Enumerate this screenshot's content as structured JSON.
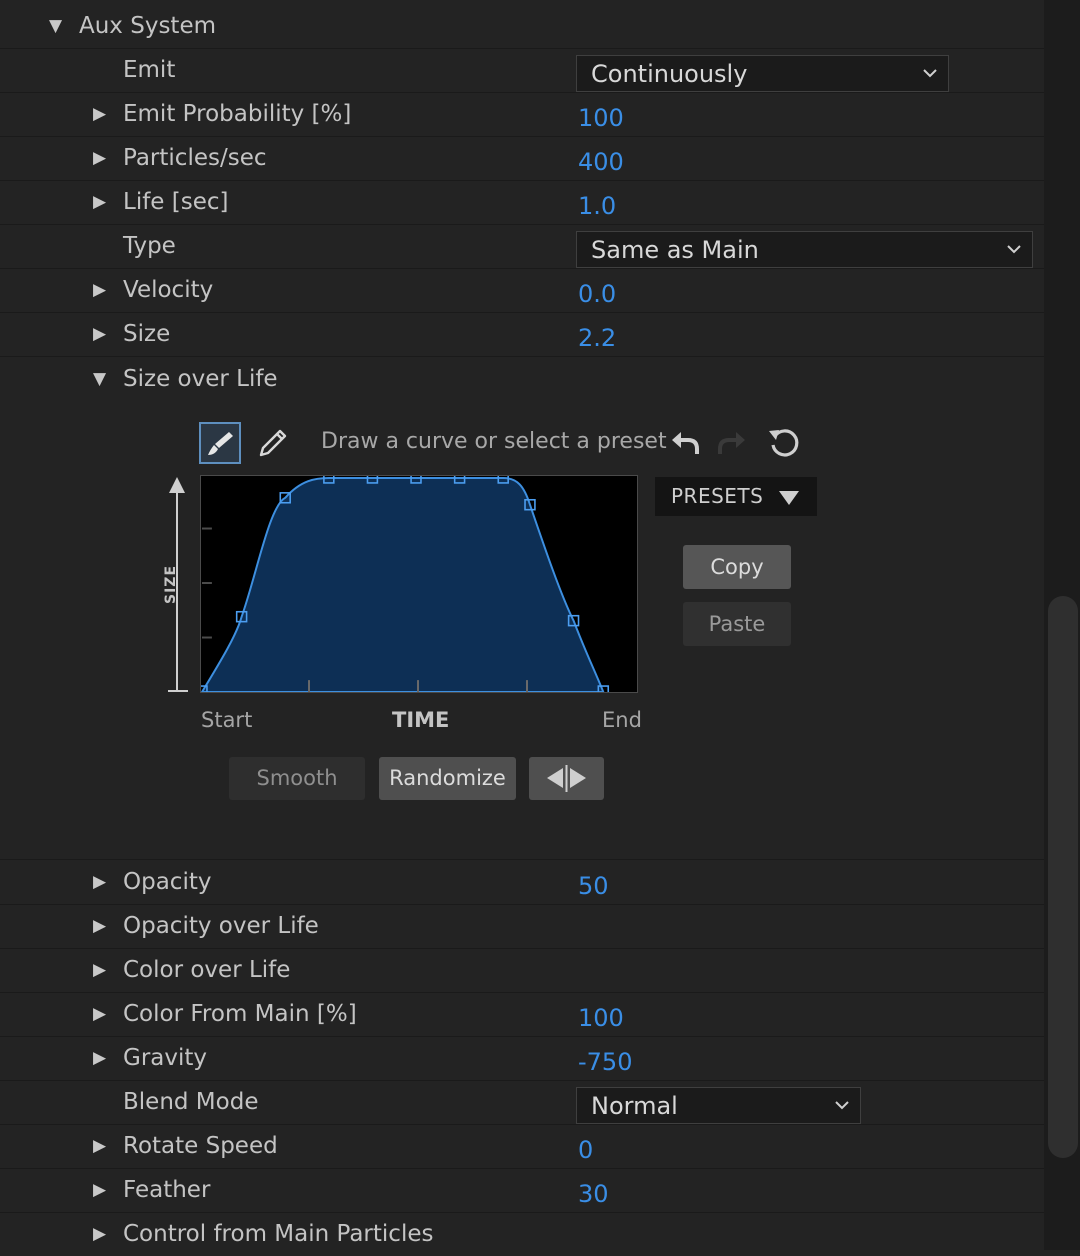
{
  "section": {
    "title": "Aux System"
  },
  "rows": {
    "emit": {
      "label": "Emit",
      "value": "Continuously"
    },
    "emit_probability": {
      "label": "Emit Probability [%]",
      "value": "100"
    },
    "particles_sec": {
      "label": "Particles/sec",
      "value": "400"
    },
    "life": {
      "label": "Life [sec]",
      "value": "1.0"
    },
    "type": {
      "label": "Type",
      "value": "Same as Main"
    },
    "velocity": {
      "label": "Velocity",
      "value": "0.0"
    },
    "size": {
      "label": "Size",
      "value": "2.2"
    },
    "size_over_life": {
      "label": "Size over Life"
    },
    "opacity": {
      "label": "Opacity",
      "value": "50"
    },
    "opacity_over_life": {
      "label": "Opacity over Life"
    },
    "color_over_life": {
      "label": "Color over Life"
    },
    "color_from_main": {
      "label": "Color From Main [%]",
      "value": "100"
    },
    "gravity": {
      "label": "Gravity",
      "value": "-750"
    },
    "blend_mode": {
      "label": "Blend Mode",
      "value": "Normal"
    },
    "rotate_speed": {
      "label": "Rotate Speed",
      "value": "0"
    },
    "feather": {
      "label": "Feather",
      "value": "30"
    },
    "control_from_main": {
      "label": "Control from Main Particles"
    }
  },
  "curve_editor": {
    "hint": "Draw a curve or select a preset",
    "x_start": "Start",
    "x_label": "TIME",
    "x_end": "End",
    "y_label": "SIZE",
    "presets_label": "PRESETS",
    "copy_label": "Copy",
    "paste_label": "Paste",
    "smooth_label": "Smooth",
    "randomize_label": "Randomize",
    "curve_fill_color": "#0d2f55",
    "curve_stroke_color": "#3d8fe0"
  },
  "colors": {
    "accent_value": "#3a8ee6",
    "panel_bg": "#232323"
  }
}
